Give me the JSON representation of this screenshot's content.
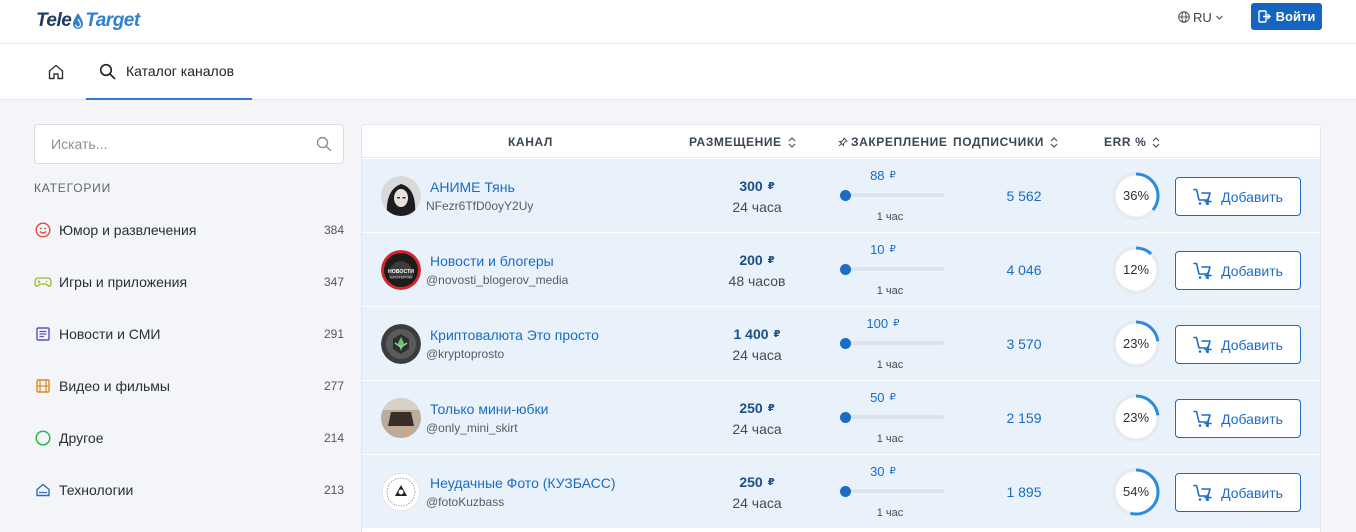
{
  "brand": {
    "part1": "Tele",
    "part2": "Target"
  },
  "header": {
    "lang": "RU",
    "login_label": "Войти"
  },
  "nav": {
    "catalog_label": "Каталог каналов"
  },
  "search": {
    "placeholder": "Искать..."
  },
  "sidebar": {
    "title": "КАТЕГОРИИ",
    "categories": [
      {
        "label": "Юмор и развлечения",
        "count": "384",
        "icon": "smile-icon",
        "color": "#e0473d"
      },
      {
        "label": "Игры и приложения",
        "count": "347",
        "icon": "gamepad-icon",
        "color": "#9bb829"
      },
      {
        "label": "Новости и СМИ",
        "count": "291",
        "icon": "newspaper-icon",
        "color": "#5b4fd1"
      },
      {
        "label": "Видео и фильмы",
        "count": "277",
        "icon": "film-icon",
        "color": "#e08a1e"
      },
      {
        "label": "Другое",
        "count": "214",
        "icon": "circle-icon",
        "color": "#2fb84a"
      },
      {
        "label": "Технологии",
        "count": "213",
        "icon": "home-tech-icon",
        "color": "#2a6bc4"
      }
    ]
  },
  "table": {
    "headers": {
      "channel": "КАНАЛ",
      "placement": "РАЗМЕЩЕНИЕ",
      "pin": "ЗАКРЕПЛЕНИЕ",
      "subscribers": "ПОДПИСЧИКИ",
      "err": "ERR %"
    },
    "currency": "₽",
    "add_label": "Добавить",
    "rows": [
      {
        "name": "АНИМЕ Тянь",
        "handle": "NFezr6TfD0oyY2Uy",
        "price": "300",
        "duration": "24 часа",
        "pin_price": "88",
        "pin_duration": "1 час",
        "pin_level": 0.0,
        "subscribers": "5 562",
        "err_value": 36,
        "err": "36%",
        "avatar": "anime"
      },
      {
        "name": "Новости и блогеры",
        "handle": "@novosti_blogerov_media",
        "price": "200",
        "duration": "48 часов",
        "pin_price": "10",
        "pin_duration": "1 час",
        "pin_level": 0.0,
        "subscribers": "4 046",
        "err_value": 12,
        "err": "12%",
        "avatar": "news",
        "avatar_text": [
          "НОВОСТИ",
          "БЛОГЕРОВ"
        ]
      },
      {
        "name": "Криптовалюта Это просто",
        "handle": "@kryptoprosto",
        "price": "1 400",
        "duration": "24 часа",
        "pin_price": "100",
        "pin_duration": "1 час",
        "pin_level": 0.0,
        "subscribers": "3 570",
        "err_value": 23,
        "err": "23%",
        "avatar": "crypto"
      },
      {
        "name": "Только мини-юбки",
        "handle": "@only_mini_skirt",
        "price": "250",
        "duration": "24 часа",
        "pin_price": "50",
        "pin_duration": "1 час",
        "pin_level": 0.0,
        "subscribers": "2 159",
        "err_value": 23,
        "err": "23%",
        "avatar": "skirt"
      },
      {
        "name": "Неудачные Фото (КУЗБАСС)",
        "handle": "@fotoKuzbass",
        "price": "250",
        "duration": "24 часа",
        "pin_price": "30",
        "pin_duration": "1 час",
        "pin_level": 0.0,
        "subscribers": "1 895",
        "err_value": 54,
        "err": "54%",
        "avatar": "foto"
      }
    ]
  },
  "colors": {
    "accent": "#1b6cc4",
    "login_bg": "#1565c0",
    "row_bg": "#e9f1fa",
    "err_ring": "#2a8be0",
    "err_track": "#e6e9ee"
  }
}
